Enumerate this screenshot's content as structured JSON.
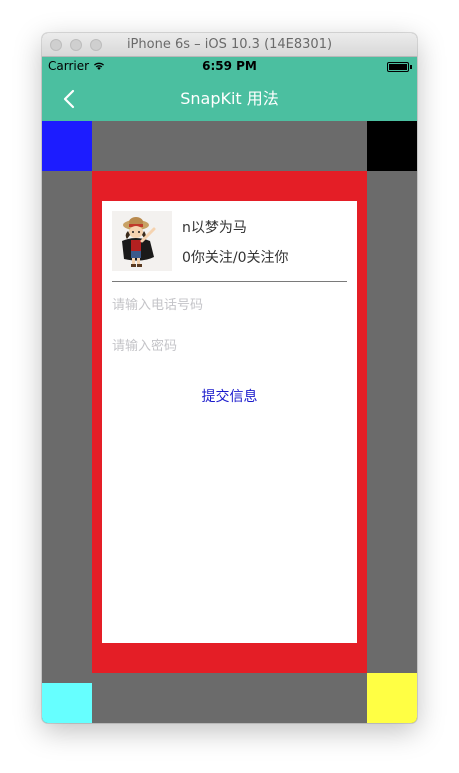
{
  "window": {
    "title": "iPhone 6s – iOS 10.3 (14E8301)"
  },
  "status_bar": {
    "carrier": "Carrier",
    "time": "6:59 PM"
  },
  "nav_bar": {
    "title": "SnapKit 用法",
    "back_icon": "chevron-left-icon"
  },
  "profile": {
    "username": "n以梦为马",
    "follow_stats": "0你关注/0关注你",
    "avatar_icon": "pirate-character-avatar"
  },
  "form": {
    "phone_placeholder": "请输入电话号码",
    "password_placeholder": "请输入密码",
    "submit_label": "提交信息"
  },
  "colors": {
    "nav_bg": "#4bbfa0",
    "background_gray": "#6b6b6b",
    "red_box": "#e41e26",
    "top_left": "#1c1cff",
    "top_right": "#000000",
    "bottom_left": "#66ffff",
    "bottom_right": "#ffff44",
    "submit_text": "#1a1acc"
  }
}
